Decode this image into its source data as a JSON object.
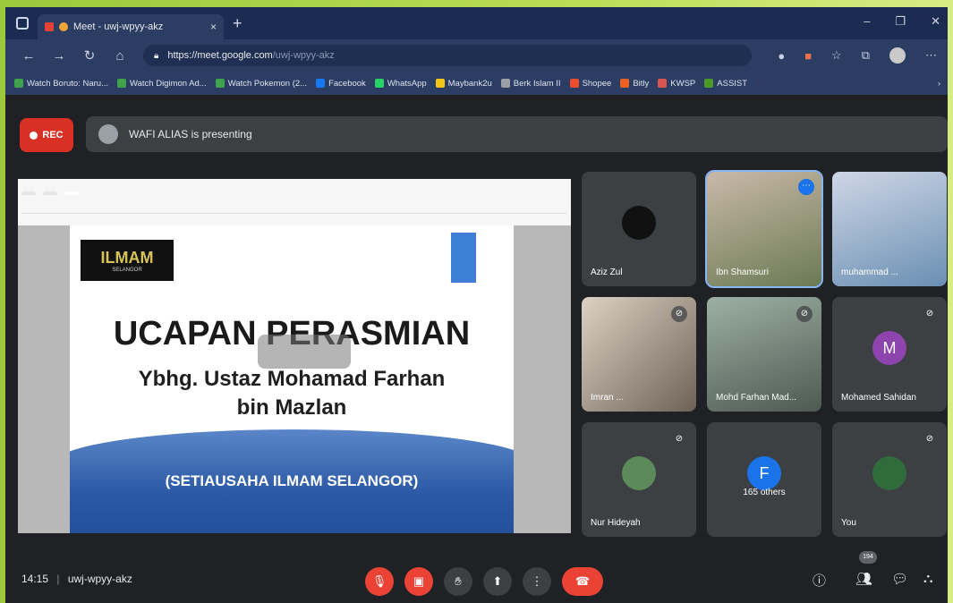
{
  "browser": {
    "tab_title": "Meet - uwj-wpyy-akz",
    "tab_close": "×",
    "new_tab": "+",
    "window_controls": [
      "–",
      "❐",
      "✕"
    ],
    "url_host": "https://meet.google.com",
    "url_path": "/uwj-wpyy-akz",
    "bookmarks": [
      {
        "label": "Watch Boruto: Naru...",
        "color": "#3fa34d"
      },
      {
        "label": "Watch Digimon Ad...",
        "color": "#3fa34d"
      },
      {
        "label": "Watch Pokemon (2...",
        "color": "#3fa34d"
      },
      {
        "label": "Facebook",
        "color": "#1877f2"
      },
      {
        "label": "WhatsApp",
        "color": "#25d366"
      },
      {
        "label": "Maybank2u",
        "color": "#f5c518"
      },
      {
        "label": "Berk Islam II",
        "color": "#9aa0a6"
      },
      {
        "label": "Shopee",
        "color": "#ee4d2d"
      },
      {
        "label": "Bitly",
        "color": "#ee6123"
      },
      {
        "label": "KWSP",
        "color": "#d9534f"
      },
      {
        "label": "ASSIST",
        "color": "#4c9a2a"
      }
    ]
  },
  "meet": {
    "rec_label": "REC",
    "presenting_text": "WAFI ALIAS is presenting",
    "slide": {
      "logo_text": "ILMAM",
      "logo_sub": "SELANGOR",
      "title": "UCAPAN PERASMIAN",
      "subtitle_line1": "Ybhg. Ustaz Mohamad Farhan",
      "subtitle_line2": "bin Mazlan",
      "footer": "(SETIAUSAHA ILMAM SELANGOR)"
    },
    "participants": [
      {
        "name": "Aziz Zul",
        "initial": "",
        "muted": false
      },
      {
        "name": "Ibn Shamsuri",
        "initial": "",
        "muted": false
      },
      {
        "name": "muhammad ...",
        "initial": "",
        "muted": false
      },
      {
        "name": "Imran ...",
        "initial": "",
        "muted": true
      },
      {
        "name": "Mohd Farhan Mad...",
        "initial": "",
        "muted": true
      },
      {
        "name": "Mohamed Sahidan",
        "initial": "M",
        "muted": true
      },
      {
        "name": "Nur Hideyah",
        "initial": "",
        "muted": true
      },
      {
        "name": "165 others",
        "initial": "F",
        "muted": false
      },
      {
        "name": "You",
        "initial": "",
        "muted": true
      }
    ],
    "time": "14:15",
    "separator": "|",
    "meeting_code": "uwj-wpyy-akz",
    "participant_count": "194"
  }
}
